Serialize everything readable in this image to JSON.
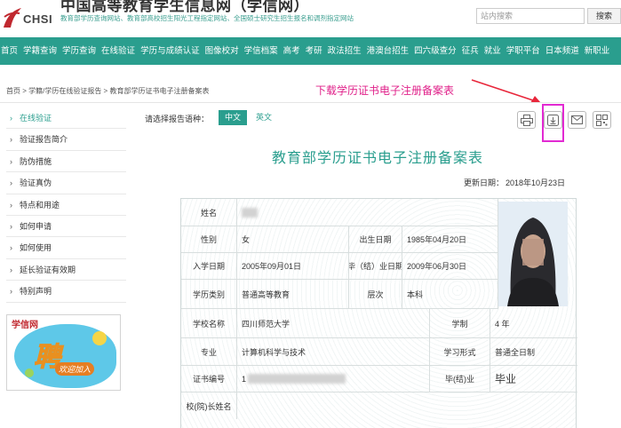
{
  "header": {
    "logo_text": "CHSI",
    "site_title": "中国高等教育学生信息网（学信网）",
    "site_subtitle": "教育部学历查询网站、教育部高校招生阳光工程指定网站、全国硕士研究生招生报名和调剂指定网站",
    "search_placeholder": "站内搜索",
    "search_button": "搜索"
  },
  "nav": {
    "items": [
      "首页",
      "学籍查询",
      "学历查询",
      "在线验证",
      "学历与成绩认证",
      "图像校对",
      "学信档案",
      "高考",
      "考研",
      "政法招生",
      "港澳台招生",
      "四六级查分",
      "征兵",
      "就业",
      "学职平台",
      "日本频道",
      "新职业"
    ]
  },
  "breadcrumb": "首页 > 学籍/学历在线验证报告 > 教育部学历证书电子注册备案表",
  "annotation": "下载学历证书电子注册备案表",
  "sidebar": {
    "items": [
      "在线验证",
      "验证报告简介",
      "防伪措施",
      "验证真伪",
      "特点和用途",
      "如何申请",
      "如何使用",
      "延长验证有效期",
      "特别声明"
    ],
    "active_index": 0,
    "banner": {
      "logo": "学信网",
      "title": "聘",
      "subtitle": "欢迎加入"
    }
  },
  "language": {
    "label": "请选择报告语种：",
    "options": [
      "中文",
      "英文"
    ],
    "selected": "中文"
  },
  "actions": [
    "printer-icon",
    "download-icon",
    "mail-icon",
    "qrcode-icon"
  ],
  "report": {
    "title": "教育部学历证书电子注册备案表",
    "update_label": "更新日期：",
    "update_date": "2018年10月23日",
    "fields": {
      "name_label": "姓名",
      "gender_label": "性别",
      "gender_value": "女",
      "birth_label": "出生日期",
      "birth_value": "1985年04月20日",
      "enroll_label": "入学日期",
      "enroll_value": "2005年09月01日",
      "grad_label": "毕（结）业日期",
      "grad_value": "2009年06月30日",
      "type_label": "学历类别",
      "type_value": "普通高等教育",
      "level_label": "层次",
      "level_value": "本科",
      "school_label": "学校名称",
      "school_value": "四川师范大学",
      "length_label": "学制",
      "length_value": "4 年",
      "major_label": "专业",
      "major_value": "计算机科学与技术",
      "form_label": "学习形式",
      "form_value": "普通全日制",
      "cert_label": "证书编号",
      "cert_prefix": "1",
      "status_label": "毕(结)业",
      "status_value": "毕业",
      "president_label": "校(院)长姓名"
    }
  },
  "colors": {
    "brand": "#2a9e8e",
    "annotation": "#e0218a",
    "highlight": "#e22ad2",
    "arrow": "#e8263a"
  }
}
